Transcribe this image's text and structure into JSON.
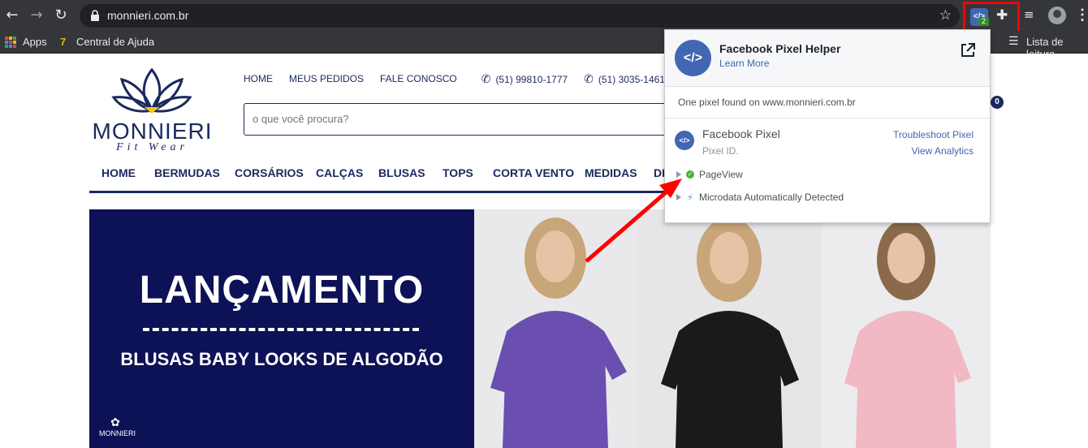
{
  "browser": {
    "url": "monnieri.com.br",
    "bookmarks": [
      "Apps",
      "Central de Ajuda"
    ],
    "reading_list_label": "Lista de leitura",
    "extension_badge": "2",
    "extension_icon_label": "</>"
  },
  "site": {
    "logo_text": "MONNIERI",
    "logo_sub": "Fit Wear",
    "top_links": [
      "HOME",
      "MEUS PEDIDOS",
      "FALE CONOSCO"
    ],
    "phones": [
      "(51) 99810-1777",
      "(51) 3035-1461"
    ],
    "search_placeholder": "o que você procura?",
    "cart_count": "0",
    "nav": [
      "HOME",
      "BERMUDAS",
      "CORSÁRIOS",
      "CALÇAS",
      "BLUSAS",
      "TOPS",
      "CORTA VENTO",
      "MEDIDAS",
      "DE"
    ],
    "banner": {
      "title": "LANÇAMENTO",
      "subtitle": "BLUSAS BABY LOOKS DE ALGODÃO",
      "logo_text": "MONNIERI",
      "shirt_colors": [
        "#6a4fb0",
        "#1a1a1a",
        "#f2b8c4"
      ]
    }
  },
  "popup": {
    "title": "Facebook Pixel Helper",
    "learn_more": "Learn More",
    "found_text": "One pixel found on www.monnieri.com.br",
    "pixel_name": "Facebook Pixel",
    "pixel_id": "Pixel ID.",
    "troubleshoot": "Troubleshoot Pixel",
    "view_analytics": "View Analytics",
    "events": [
      "PageView",
      "Microdata Automatically Detected"
    ],
    "logo_label": "</>"
  },
  "colors": {
    "brand_navy": "#1a2a5e",
    "facebook_blue": "#4267b2",
    "highlight_red": "#ff0000",
    "success_green": "#42b72a"
  }
}
